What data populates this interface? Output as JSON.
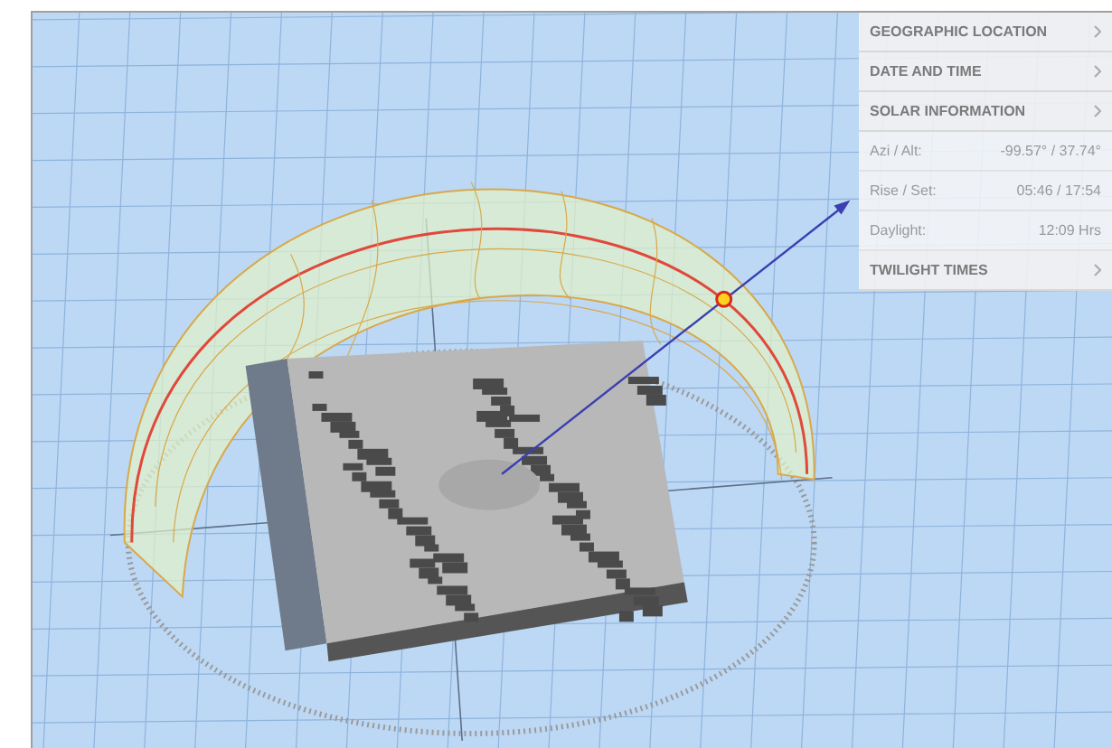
{
  "panel": {
    "sections": [
      {
        "title": "GEOGRAPHIC LOCATION"
      },
      {
        "title": "DATE AND TIME"
      },
      {
        "title": "SOLAR INFORMATION",
        "rows": [
          {
            "label": "Azi / Alt:",
            "value": "-99.57° / 37.74°"
          },
          {
            "label": "Rise / Set:",
            "value": "05:46 / 17:54"
          },
          {
            "label": "Daylight:",
            "value": "12:09 Hrs"
          }
        ]
      },
      {
        "title": "TWILIGHT TIMES"
      }
    ]
  }
}
